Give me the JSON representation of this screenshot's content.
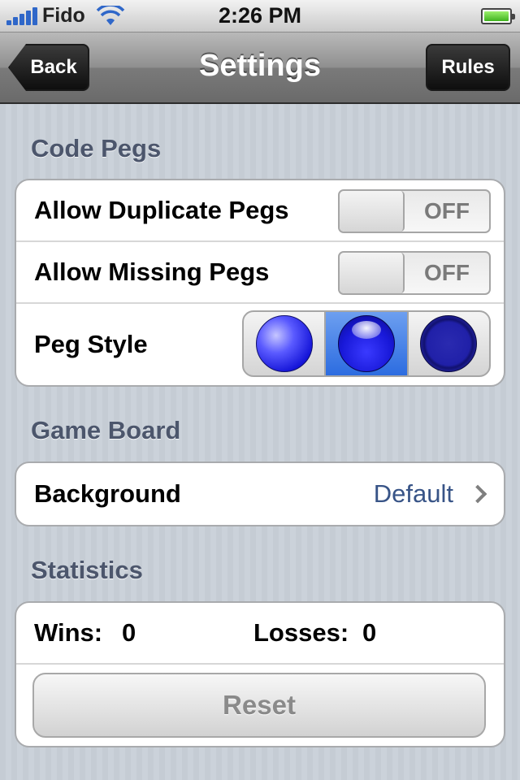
{
  "status_bar": {
    "carrier": "Fido",
    "time": "2:26 PM"
  },
  "nav": {
    "title": "Settings",
    "back_label": "Back",
    "rules_label": "Rules"
  },
  "code_pegs": {
    "header": "Code Pegs",
    "allow_duplicate": {
      "label": "Allow Duplicate Pegs",
      "state": "OFF"
    },
    "allow_missing": {
      "label": "Allow Missing Pegs",
      "state": "OFF"
    },
    "peg_style": {
      "label": "Peg Style",
      "options": [
        "glossy-sphere",
        "shiny-highlight",
        "flat-ring"
      ],
      "selected_index": 1
    }
  },
  "game_board": {
    "header": "Game Board",
    "background": {
      "label": "Background",
      "value": "Default"
    }
  },
  "statistics": {
    "header": "Statistics",
    "wins_label": "Wins:",
    "wins_value": "0",
    "losses_label": "Losses:",
    "losses_value": "0",
    "reset_label": "Reset"
  },
  "colors": {
    "section_header": "#4c566c",
    "detail_value": "#385487",
    "segment_selected": "#2c6ce0",
    "peg_blue": "#1414d8"
  }
}
